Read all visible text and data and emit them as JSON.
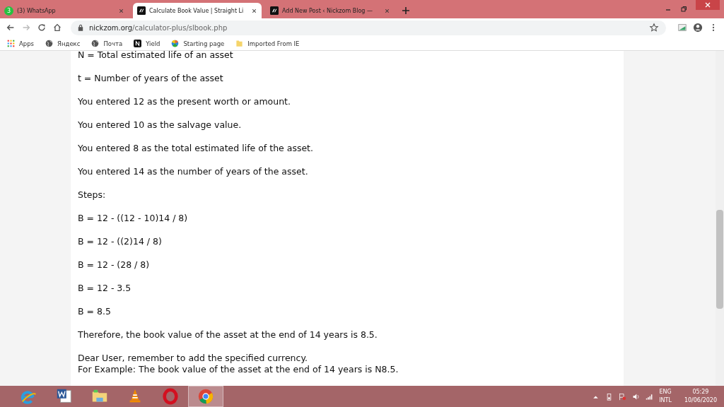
{
  "tabs": [
    {
      "label": "(3) WhatsApp",
      "badge": "3",
      "kind": "whatsapp",
      "selected": false
    },
    {
      "label": "Calculate Book Value | Straight Li",
      "kind": "site",
      "selected": true
    },
    {
      "label": "Add New Post ‹ Nickzom Blog —",
      "kind": "site",
      "selected": false
    }
  ],
  "address": {
    "host": "nickzom.org",
    "path": "/calculator-plus/slbook.php"
  },
  "bookmarks": [
    {
      "label": "Apps",
      "kind": "apps"
    },
    {
      "label": "Яндекс",
      "kind": "globe"
    },
    {
      "label": "Почта",
      "kind": "globe"
    },
    {
      "label": "Yield",
      "kind": "n"
    },
    {
      "label": "Starting page",
      "kind": "ball"
    },
    {
      "label": "Imported From IE",
      "kind": "folder"
    }
  ],
  "content": {
    "paragraphs": [
      "N = Total estimated life of an asset",
      "t = Number of years of the asset",
      "You entered 12 as the present worth or amount.",
      "You entered 10 as the salvage value.",
      "You entered 8 as the total estimated life of the asset.",
      "You entered 14 as the number of years of the asset.",
      "Steps:",
      "B = 12 - ((12 - 10)14 / 8)",
      "B = 12 - ((2)14 / 8)",
      "B = 12 - (28 / 8)",
      "B = 12 - 3.5",
      "B = 8.5",
      "Therefore, the book value of the asset at the end of 14 years is 8.5.",
      "Dear User, remember to add the specified currency.\nFor Example: The book value of the asset at the end of 14 years is N8.5."
    ]
  },
  "taskbar": {
    "apps": [
      {
        "kind": "ie",
        "selected": false
      },
      {
        "kind": "word",
        "selected": false
      },
      {
        "kind": "explorer",
        "selected": false
      },
      {
        "kind": "vlc",
        "selected": false
      },
      {
        "kind": "opera",
        "selected": false
      },
      {
        "kind": "chrome",
        "selected": true
      }
    ],
    "language": "ENG",
    "layout": "INTL",
    "time": "05:29",
    "date": "10/06/2020"
  }
}
